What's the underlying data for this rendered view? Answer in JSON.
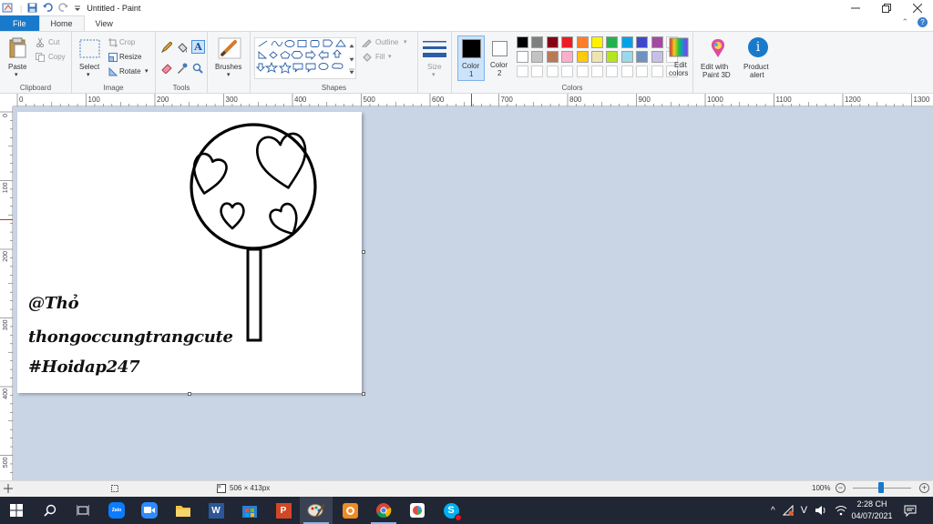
{
  "window": {
    "title": "Untitled - Paint"
  },
  "tabs": {
    "file": "File",
    "home": "Home",
    "view": "View"
  },
  "ribbon": {
    "clipboard": {
      "paste": "Paste",
      "cut": "Cut",
      "copy": "Copy",
      "group": "Clipboard"
    },
    "image": {
      "select": "Select",
      "crop": "Crop",
      "resize": "Resize",
      "rotate": "Rotate",
      "group": "Image"
    },
    "tools": {
      "group": "Tools"
    },
    "brushes": {
      "label": "Brushes"
    },
    "shapes": {
      "outline": "Outline",
      "fill": "Fill",
      "group": "Shapes"
    },
    "size": {
      "label": "Size"
    },
    "colors": {
      "color1": "Color",
      "color1_num": "1",
      "color2": "Color",
      "color2_num": "2",
      "edit_colors_1": "Edit",
      "edit_colors_2": "colors",
      "group": "Colors",
      "palette_row1": [
        "#000000",
        "#7f7f7f",
        "#880015",
        "#ed1c24",
        "#ff7f27",
        "#fff200",
        "#22b14c",
        "#00a2e8",
        "#3f48cc",
        "#a349a4"
      ],
      "palette_row2": [
        "#ffffff",
        "#c3c3c3",
        "#b97a57",
        "#ffaec9",
        "#ffc90e",
        "#efe4b0",
        "#b5e61d",
        "#99d9ea",
        "#7092be",
        "#c8bfe7"
      ]
    },
    "paint3d": {
      "line1": "Edit with",
      "line2": "Paint 3D"
    },
    "product_alert": {
      "line1": "Product",
      "line2": "alert"
    }
  },
  "ruler": {
    "h_ticks": [
      "0",
      "100",
      "200",
      "300",
      "400",
      "500",
      "600",
      "700",
      "800",
      "900",
      "1000",
      "1100",
      "1200",
      "1300"
    ],
    "v_ticks": [
      "0",
      "100",
      "200",
      "300",
      "400",
      "500"
    ]
  },
  "canvas": {
    "text_line1": "@Thỏ",
    "text_line2": "thongoccungtrangcute",
    "text_line3": "#Hoidap247"
  },
  "status": {
    "image_size": "506 × 413px",
    "zoom": "100%"
  },
  "taskbar": {
    "time": "2:28 CH",
    "date": "04/07/2021",
    "lang": "V"
  },
  "colors": {
    "accent": "#1979ca",
    "taskbar": "#202633",
    "workspace": "#c9d4e4"
  }
}
